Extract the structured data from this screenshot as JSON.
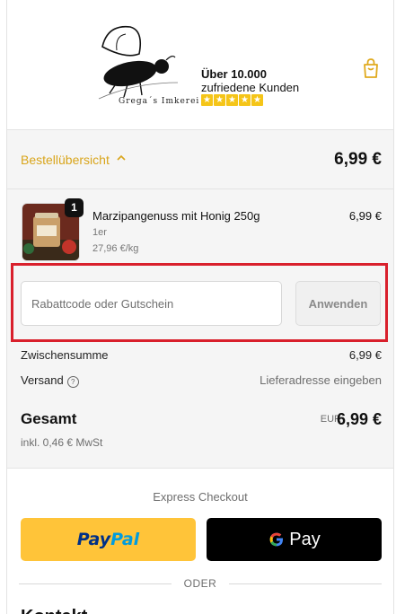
{
  "header": {
    "brand_name": "Grega´s Imkerei",
    "badge_line1": "Über 10.000",
    "badge_line2": "zufriedene Kunden",
    "rating_stars": 5
  },
  "summary_toggle": {
    "label": "Bestellübersicht",
    "total": "6,99 €"
  },
  "product": {
    "quantity": "1",
    "name": "Marzipangenuss mit Honig 250g",
    "variant": "1er",
    "unit_price": "27,96 €/kg",
    "price": "6,99 €"
  },
  "discount": {
    "placeholder": "Rabattcode oder Gutschein",
    "apply_label": "Anwenden"
  },
  "totals": {
    "subtotal_label": "Zwischensumme",
    "subtotal_value": "6,99 €",
    "shipping_label": "Versand",
    "shipping_value": "Lieferadresse eingeben",
    "total_label": "Gesamt",
    "currency": "EUR",
    "total_value": "6,99 €",
    "tax_note": "inkl. 0,46 € MwSt"
  },
  "express": {
    "title": "Express Checkout",
    "paypal_pay": "Pay",
    "paypal_pal": "Pal",
    "gpay_label": "Pay",
    "divider": "ODER"
  },
  "contact": {
    "heading": "Kontakt"
  },
  "colors": {
    "accent": "#d9a51b",
    "highlight_border": "#d9202c",
    "paypal_yellow": "#ffc439"
  }
}
